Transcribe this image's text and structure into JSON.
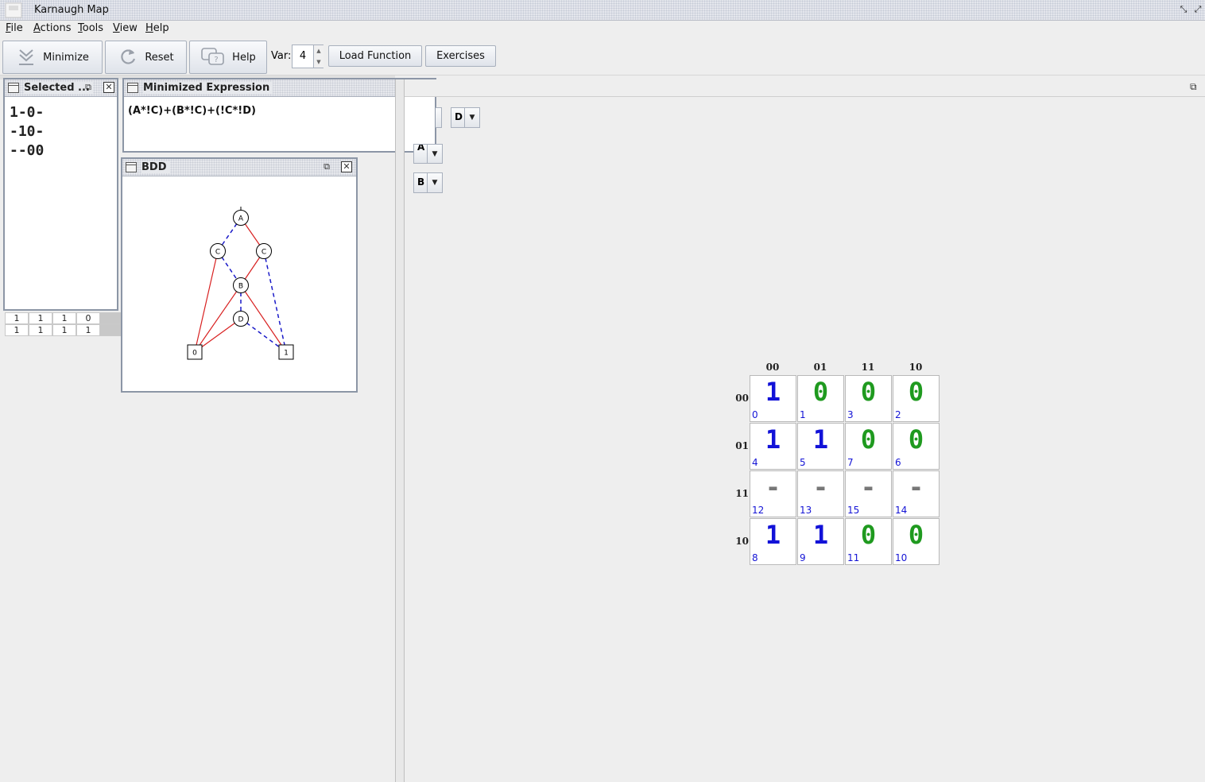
{
  "window": {
    "title": "Karnaugh Map"
  },
  "menu": [
    {
      "mnemonic": "F",
      "rest": "ile"
    },
    {
      "mnemonic": "A",
      "rest": "ctions"
    },
    {
      "mnemonic": "T",
      "rest": "ools"
    },
    {
      "mnemonic": "V",
      "rest": "iew"
    },
    {
      "mnemonic": "H",
      "rest": "elp"
    }
  ],
  "toolbar": {
    "minimize_label": "Minimize",
    "reset_label": "Reset",
    "help_label": "Help",
    "var_label": "Var:",
    "var_value": "4",
    "load_function_label": "Load Function",
    "exercises_label": "Exercises"
  },
  "selected_panel": {
    "title": "Selected ...",
    "lines": [
      "1-0-",
      "-10-",
      "--00"
    ]
  },
  "table_fragment": [
    [
      "1",
      "1",
      "1",
      "0"
    ],
    [
      "1",
      "1",
      "1",
      "1"
    ]
  ],
  "minimized_panel": {
    "title": "Minimized Expression",
    "expression": "(A*!C)+(B*!C)+(!C*!D)"
  },
  "bdd_panel": {
    "title": "BDD",
    "nodes": {
      "a": "A",
      "c1": "C",
      "c2": "C",
      "b": "B",
      "d": "D",
      "t0": "0",
      "t1": "1"
    }
  },
  "variable_selectors": {
    "d": "D",
    "a": "A",
    "b": "B"
  },
  "kmap": {
    "column_headers": [
      "00",
      "01",
      "11",
      "10"
    ],
    "row_headers": [
      "00",
      "01",
      "11",
      "10"
    ],
    "cells": [
      [
        {
          "value": "1",
          "index": "0"
        },
        {
          "value": "0",
          "index": "1"
        },
        {
          "value": "0",
          "index": "3"
        },
        {
          "value": "0",
          "index": "2"
        }
      ],
      [
        {
          "value": "1",
          "index": "4"
        },
        {
          "value": "1",
          "index": "5"
        },
        {
          "value": "0",
          "index": "7"
        },
        {
          "value": "0",
          "index": "6"
        }
      ],
      [
        {
          "value": "-",
          "index": "12"
        },
        {
          "value": "-",
          "index": "13"
        },
        {
          "value": "-",
          "index": "15"
        },
        {
          "value": "-",
          "index": "14"
        }
      ],
      [
        {
          "value": "1",
          "index": "8"
        },
        {
          "value": "1",
          "index": "9"
        },
        {
          "value": "0",
          "index": "11"
        },
        {
          "value": "0",
          "index": "10"
        }
      ]
    ],
    "colors": {
      "one": "#1212d8",
      "zero": "#1f9a1f",
      "dont_care": "#777777"
    }
  }
}
